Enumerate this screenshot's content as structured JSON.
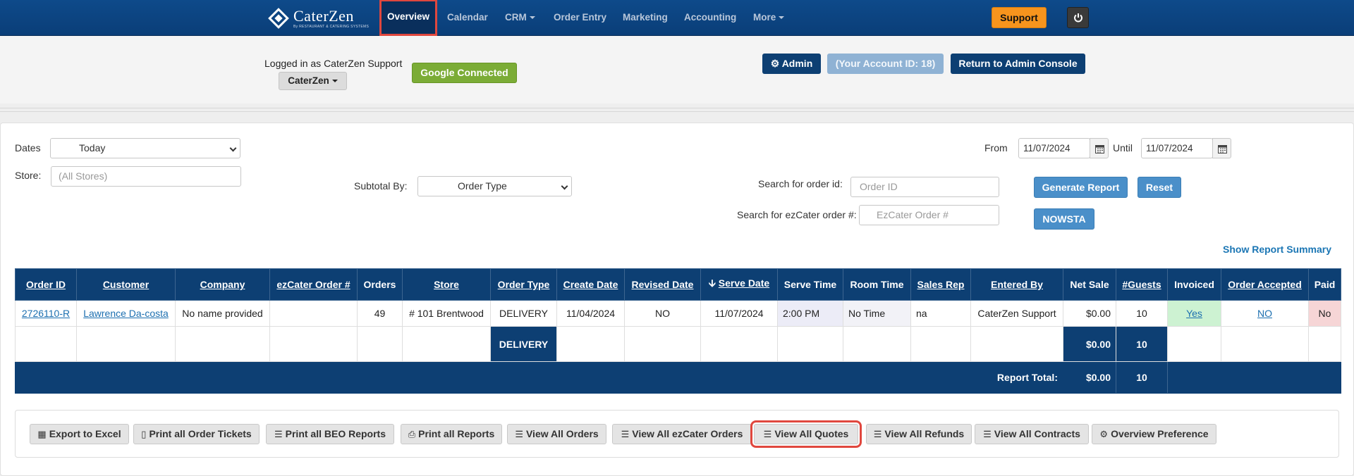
{
  "brand": {
    "name": "CaterZen",
    "tagline": "By RESTAURANT & CATERING SYSTEMS"
  },
  "nav": {
    "items": [
      {
        "label": "Overview",
        "active": true
      },
      {
        "label": "Calendar"
      },
      {
        "label": "CRM",
        "dropdown": true
      },
      {
        "label": "Order Entry"
      },
      {
        "label": "Marketing"
      },
      {
        "label": "Accounting"
      },
      {
        "label": "More",
        "dropdown": true
      }
    ],
    "support_label": "Support",
    "power_icon": "power-icon"
  },
  "header": {
    "logged_in_text": "Logged in as CaterZen Support",
    "account_menu_label": "CaterZen",
    "google_label": "Google Connected",
    "admin_label": "Admin",
    "account_id_label": "(Your Account ID: 18)",
    "return_label": "Return to Admin Console"
  },
  "filters": {
    "dates_label": "Dates",
    "dates_value": "Today",
    "store_label": "Store:",
    "store_placeholder": "(All Stores)",
    "subtotal_label": "Subtotal By:",
    "subtotal_value": "Order Type",
    "from_label": "From",
    "from_value": "11/07/2024",
    "until_label": "Until",
    "until_value": "11/07/2024",
    "search_order_label": "Search for order id:",
    "search_order_placeholder": "Order ID",
    "search_ez_label": "Search for ezCater order #:",
    "search_ez_placeholder": "EzCater Order #",
    "generate_label": "Generate Report",
    "reset_label": "Reset",
    "nowsta_label": "NOWSTA",
    "summary_link": "Show Report Summary"
  },
  "table": {
    "headers": [
      "Order ID",
      "Customer",
      "Company",
      "ezCater Order #",
      "Orders",
      "Store",
      "Order Type",
      "Create Date",
      "Revised Date",
      "Serve Date",
      "Serve Time",
      "Room Time",
      "Sales Rep",
      "Entered By",
      "Net Sale",
      "#Guests",
      "Invoiced",
      "Order Accepted",
      "Paid"
    ],
    "row": {
      "order_id": "2726110-R",
      "customer": "Lawrence Da-costa",
      "company": "No name provided",
      "ezcater": "",
      "orders": "49",
      "store": "# 101 Brentwood",
      "order_type": "DELIVERY",
      "create_date": "11/04/2024",
      "revised_date": "NO",
      "serve_date": "11/07/2024",
      "serve_time": "2:00 PM",
      "room_time": "No Time",
      "sales_rep": "na",
      "entered_by": "CaterZen Support",
      "net_sale": "$0.00",
      "guests": "10",
      "invoiced": "Yes",
      "accepted": "NO",
      "paid": "No"
    },
    "subtotal": {
      "label": "DELIVERY",
      "net_sale": "$0.00",
      "guests": "10"
    },
    "total": {
      "label": "Report Total:",
      "net_sale": "$0.00",
      "guests": "10"
    }
  },
  "toolbar": {
    "buttons": [
      {
        "label": "Export to Excel",
        "icon": "grid-icon"
      },
      {
        "label": "Print all Order Tickets",
        "icon": "mobile-icon"
      },
      {
        "label": "Print all BEO Reports",
        "icon": "list-icon"
      },
      {
        "label": "Print all Reports",
        "icon": "print-icon"
      },
      {
        "label": "View All Orders",
        "icon": "list-icon"
      },
      {
        "label": "View All ezCater Orders",
        "icon": "list-icon"
      },
      {
        "label": "View All Quotes",
        "icon": "list-icon",
        "highlighted": true
      },
      {
        "label": "View All Refunds",
        "icon": "list-icon"
      },
      {
        "label": "View All Contracts",
        "icon": "list-icon"
      },
      {
        "label": "Overview Preference",
        "icon": "gear-icon"
      }
    ]
  },
  "colors": {
    "navy": "#0d3f73",
    "accent_blue": "#4a8fc9",
    "support_orange": "#f7941d",
    "google_green": "#7bac36",
    "highlight_red": "#e0473e"
  }
}
